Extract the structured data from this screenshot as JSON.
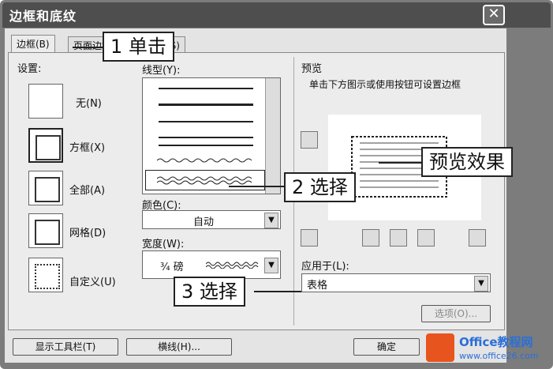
{
  "window": {
    "title": "边框和底纹",
    "close_glyph": "✕"
  },
  "tabs": [
    {
      "label": "边框(B)"
    },
    {
      "label": "页面边框(P)"
    },
    {
      "label": "底纹(S)"
    }
  ],
  "settings": {
    "header": "设置:",
    "items": [
      {
        "label": "无(N)"
      },
      {
        "label": "方框(X)"
      },
      {
        "label": "全部(A)"
      },
      {
        "label": "网格(D)"
      },
      {
        "label": "自定义(U)"
      }
    ]
  },
  "style": {
    "line_label": "线型(Y):",
    "color_label": "颜色(C):",
    "color_value": "自动",
    "width_label": "宽度(W):",
    "width_value": "¾ 磅"
  },
  "preview": {
    "header": "预览",
    "hint": "单击下方图示或使用按钮可设置边框",
    "apply_label": "应用于(L):",
    "apply_value": "表格",
    "options_button": "选项(O)..."
  },
  "footer": {
    "toolbar_button": "显示工具栏(T)",
    "hline_button": "横线(H)...",
    "ok_button": "确定"
  },
  "callouts": {
    "click": "1 单击",
    "select1": "2 选择",
    "select2": "3 选择",
    "preview": "预览效果"
  },
  "logo": {
    "text": "Office教程网",
    "url": "www.office26.com"
  }
}
